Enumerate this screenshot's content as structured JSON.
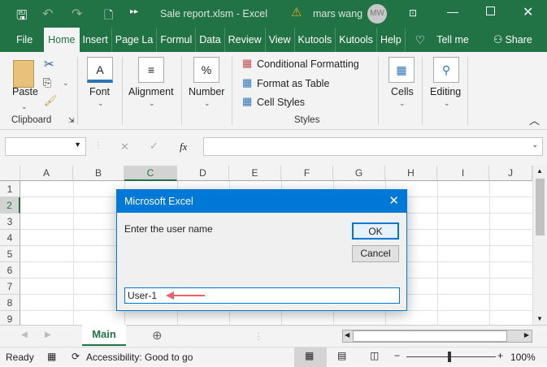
{
  "title_bar": {
    "doc_title": "Sale report.xlsm  -  Excel",
    "user_name": "mars wang",
    "avatar_initials": "MW"
  },
  "tabs": [
    "File",
    "Home",
    "Insert",
    "Page La",
    "Formul",
    "Data",
    "Review",
    "View",
    "Kutools",
    "Kutools",
    "Help"
  ],
  "tell_me": "Tell me",
  "share": "Share",
  "ribbon": {
    "paste": "Paste",
    "clipboard": "Clipboard",
    "font": "Font",
    "alignment": "Alignment",
    "number": "Number",
    "conditional_formatting": "Conditional Formatting",
    "format_as_table": "Format as Table",
    "cell_styles": "Cell Styles",
    "styles": "Styles",
    "cells": "Cells",
    "editing": "Editing"
  },
  "formula_bar": {
    "fx": "fx",
    "name_box": "",
    "formula": ""
  },
  "columns": [
    "A",
    "B",
    "C",
    "D",
    "E",
    "F",
    "G",
    "H",
    "I",
    "J"
  ],
  "rows": [
    "1",
    "2",
    "3",
    "4",
    "5",
    "6",
    "7",
    "8",
    "9"
  ],
  "sheet_tab": "Main",
  "status": {
    "ready": "Ready",
    "accessibility": "Accessibility: Good to go",
    "zoom": "100%",
    "zoom_level": 100
  },
  "dialog": {
    "title": "Microsoft Excel",
    "prompt": "Enter the user name",
    "ok": "OK",
    "cancel": "Cancel",
    "input_value": "User-1"
  },
  "colors": {
    "excel_green": "#217346",
    "dialog_blue": "#0078d7",
    "arrow": "#e8606a"
  }
}
